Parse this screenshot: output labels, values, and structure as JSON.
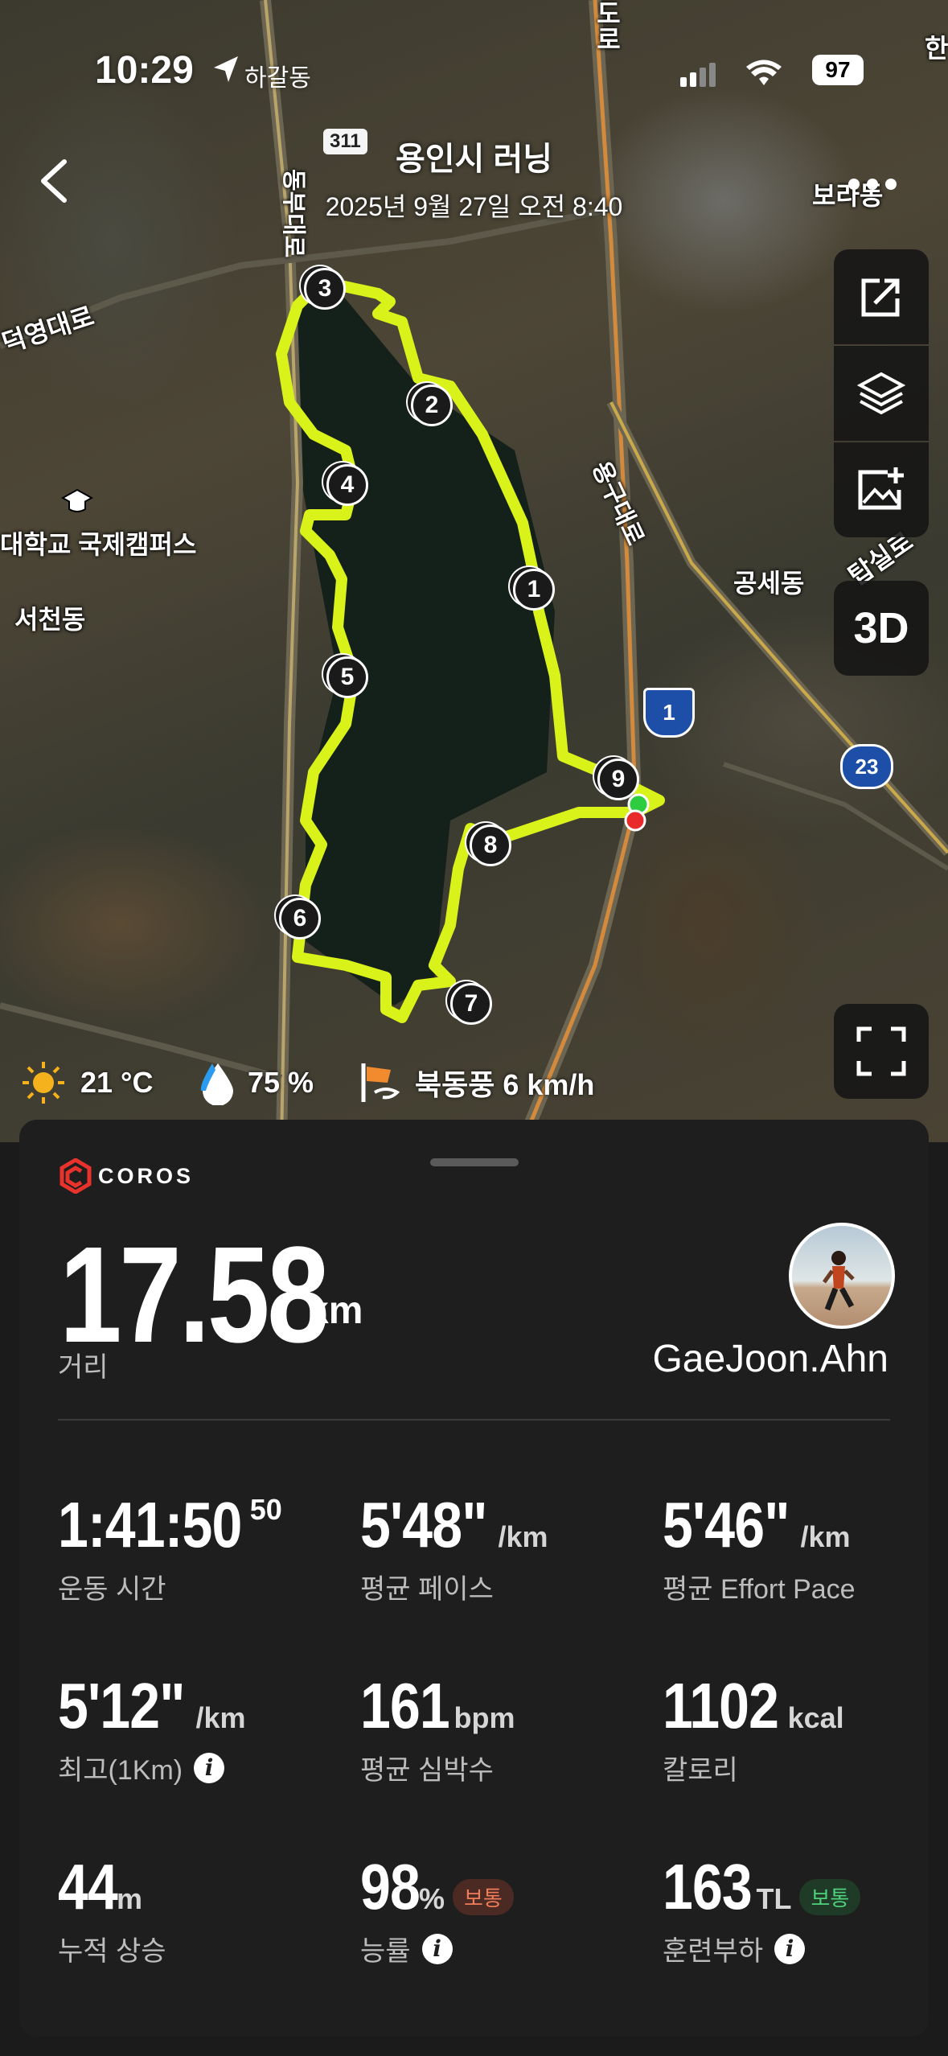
{
  "status_bar": {
    "time": "10:29",
    "location": "하갈동",
    "battery": "97"
  },
  "header": {
    "title": "용인시 러닝",
    "subtitle": "2025년 9월 27일 오전 8:40"
  },
  "map": {
    "labels": {
      "road_311": "311",
      "dongbu": "동부대로",
      "doro": "도로",
      "han": "한",
      "deokyeong": "덕영대로",
      "bora": "보라동",
      "univ": "대학교 국제캠퍼스",
      "seocheon": "서천동",
      "yonggu": "용구대로",
      "gongse": "공세동",
      "tapsil": "탑실로",
      "hw1": "1",
      "hw23": "23"
    },
    "markers": [
      "1",
      "2",
      "3",
      "4",
      "5",
      "6",
      "7",
      "8",
      "9"
    ],
    "route_color": "#d9f21a",
    "mode_3d": "3D"
  },
  "weather": {
    "temp": "21 °C",
    "humidity": "75 %",
    "wind": "북동풍 6 km/h"
  },
  "panel": {
    "brand": "COROS",
    "distance": {
      "value": "17.58",
      "unit": "km",
      "label": "거리"
    },
    "username": "GaeJoon.Ahn",
    "stats": {
      "time": {
        "value": "1:41:50",
        "sub": "50",
        "label": "운동 시간"
      },
      "avg_pace": {
        "value": "5'48\"",
        "unit": "/km",
        "label": "평균 페이스"
      },
      "effort_pace": {
        "value": "5'46\"",
        "unit": "/km",
        "label": "평균 Effort Pace"
      },
      "best": {
        "value": "5'12\"",
        "unit": "/km",
        "label": "최고(1Km)"
      },
      "heart": {
        "value": "161",
        "unit": "bpm",
        "label": "평균 심박수"
      },
      "calories": {
        "value": "1102",
        "unit": "kcal",
        "label": "칼로리"
      },
      "ascent": {
        "value": "44",
        "unit": "m",
        "label": "누적 상승"
      },
      "efficiency": {
        "value": "98",
        "unit": "%",
        "badge": "보통",
        "label": "능률"
      },
      "load": {
        "value": "163",
        "unit": "TL",
        "badge": "보통",
        "label": "훈련부하"
      }
    }
  }
}
